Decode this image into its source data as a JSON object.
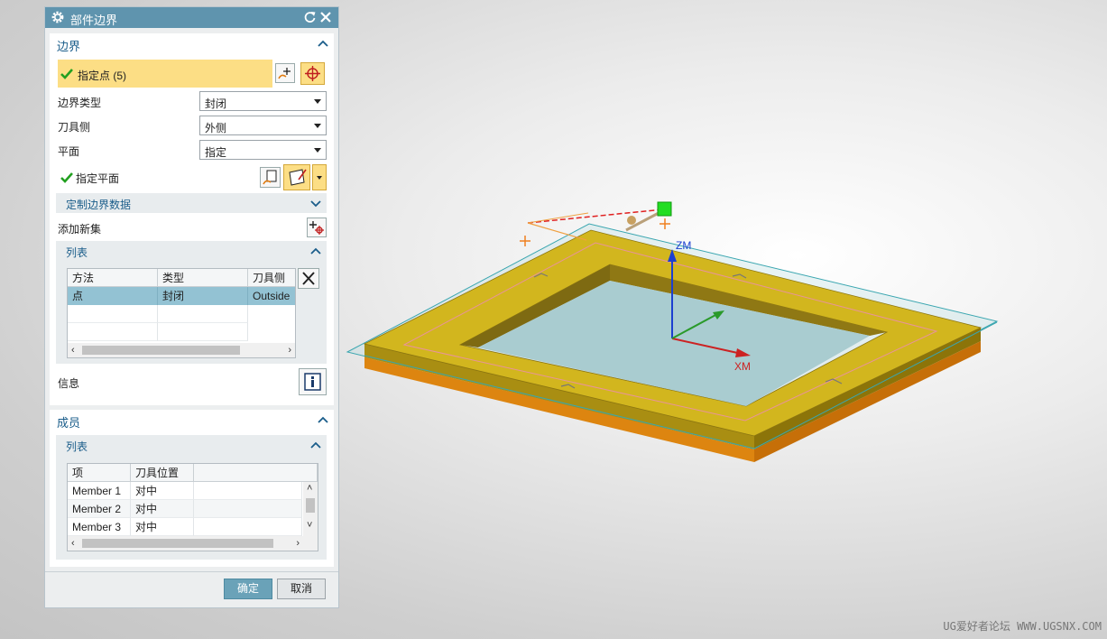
{
  "dialog": {
    "title": "部件边界",
    "boundary_group": {
      "title": "边界",
      "specify_points": "指定点 (5)",
      "fields": [
        {
          "label": "边界类型",
          "value": "封闭"
        },
        {
          "label": "刀具侧",
          "value": "外侧"
        },
        {
          "label": "平面",
          "value": "指定"
        }
      ],
      "specify_plane": "指定平面",
      "custom_data": "定制边界数据",
      "add_new_set": "添加新集",
      "list": {
        "title": "列表",
        "columns": [
          "方法",
          "类型",
          "刀具侧"
        ],
        "rows": [
          [
            "点",
            "封闭",
            "Outside"
          ]
        ]
      },
      "info": "信息"
    },
    "members_group": {
      "title": "成员",
      "list": {
        "title": "列表",
        "columns": [
          "项",
          "刀具位置"
        ],
        "rows": [
          [
            "Member 1",
            "对中"
          ],
          [
            "Member 2",
            "对中"
          ],
          [
            "Member 3",
            "对中"
          ]
        ]
      }
    },
    "ok": "确定",
    "cancel": "取消"
  },
  "viewport": {
    "axes": {
      "z": "ZM",
      "x": "XM"
    },
    "colors": {
      "frame_top": "#d1b51c",
      "frame_side": "#9c8510",
      "frame_bottom": "#de840c",
      "plane": "#9fd4d8",
      "accent": "#5f94ae"
    }
  },
  "watermark": "UG爱好者论坛 WWW.UGSNX.COM"
}
